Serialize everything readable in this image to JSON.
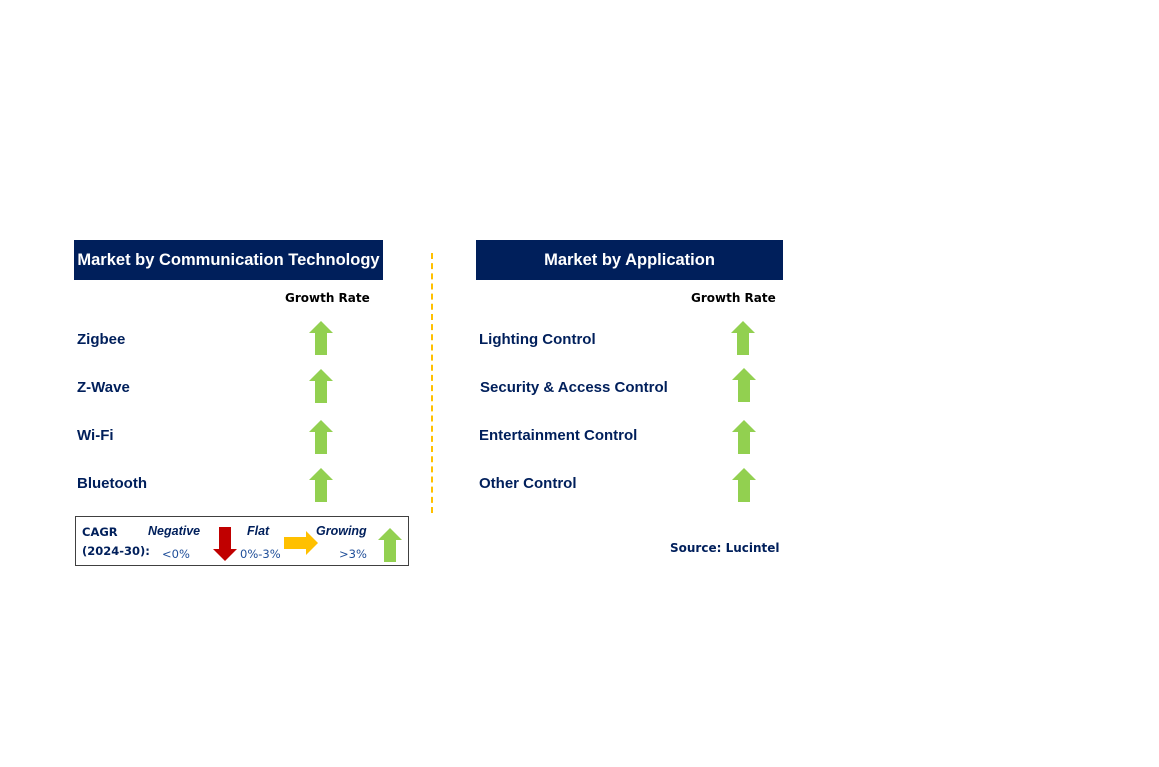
{
  "left_panel": {
    "title": "Market by Communication Technology",
    "growth_rate_label": "Growth Rate",
    "items": [
      {
        "label": "Zigbee",
        "trend": "growing"
      },
      {
        "label": "Z-Wave",
        "trend": "growing"
      },
      {
        "label": "Wi-Fi",
        "trend": "growing"
      },
      {
        "label": "Bluetooth",
        "trend": "growing"
      }
    ]
  },
  "right_panel": {
    "title": "Market by Application",
    "growth_rate_label": "Growth Rate",
    "items": [
      {
        "label": "Lighting Control",
        "trend": "growing"
      },
      {
        "label": "Security & Access Control",
        "trend": "growing"
      },
      {
        "label": "Entertainment Control",
        "trend": "growing"
      },
      {
        "label": "Other Control",
        "trend": "growing"
      }
    ]
  },
  "legend": {
    "cagr_line1": "CAGR",
    "cagr_line2": "(2024-30):",
    "negative": {
      "label": "Negative",
      "range": "<0%",
      "icon": "down-arrow-icon",
      "color": "#c00000"
    },
    "flat": {
      "label": "Flat",
      "range": "0%-3%",
      "icon": "right-arrow-icon",
      "color": "#ffc000"
    },
    "growing": {
      "label": "Growing",
      "range": ">3%",
      "icon": "up-arrow-icon",
      "color": "#92d050"
    }
  },
  "colors": {
    "header_bg": "#001f5b",
    "divider": "#ffc000",
    "text": "#001f5b"
  },
  "source": "Source: Lucintel"
}
